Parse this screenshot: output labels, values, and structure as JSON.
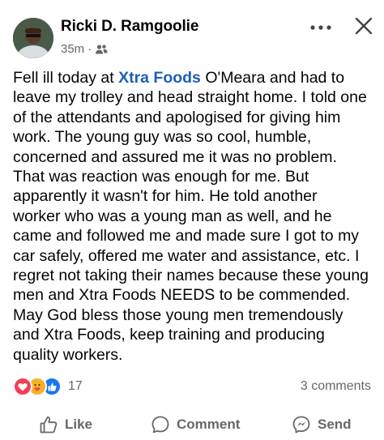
{
  "post": {
    "author": "Ricki D. Ramgoolie",
    "time": "35m",
    "separator": "·",
    "audience_icon": "friends-icon",
    "text_lines": [
      {
        "before": "Fell ill today at ",
        "brand": "Xtra Foods",
        "after": " O'Meara and had to"
      },
      {
        "text": "leave my trolley and head straight home. I told one"
      },
      {
        "text": "of the attendants and apologised for giving him"
      },
      {
        "text": "work. The young guy was so cool, humble,"
      },
      {
        "text": "concerned and assured me it was no problem."
      },
      {
        "text": "That was reaction was enough for me. But"
      },
      {
        "text": "apparently it wasn't for him. He told another"
      },
      {
        "text": "worker who was a young man as well, and he"
      },
      {
        "text": "came and followed me and made sure I got to my"
      },
      {
        "text": "car safely, offered me water and assistance, etc. I"
      },
      {
        "text": "regret not taking their names because these young"
      },
      {
        "text": "men and Xtra Foods NEEDS to be commended."
      },
      {
        "text": "May God bless those young men tremendously"
      },
      {
        "text": "and Xtra Foods, keep training and producing"
      },
      {
        "text": "quality workers."
      }
    ]
  },
  "engagement": {
    "reactions": [
      "love-icon",
      "care-icon",
      "like-icon"
    ],
    "reaction_count": "17",
    "comments": "3 comments"
  },
  "actions": {
    "like": "Like",
    "comment": "Comment",
    "send": "Send"
  },
  "colors": {
    "brand_link": "#1f5fb8",
    "secondary_text": "#65676b",
    "like_blue": "#1877f2",
    "love_red": "#f33e58",
    "care_yellow": "#f7b125"
  }
}
